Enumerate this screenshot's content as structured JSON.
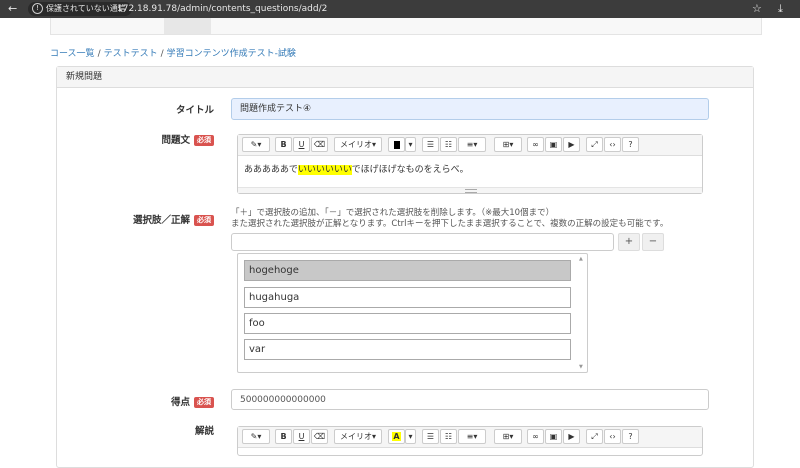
{
  "browser": {
    "security_label": "保護されていない通信",
    "url": "172.18.91.78/admin/contents_questions/add/2"
  },
  "breadcrumb": {
    "items": [
      "コース一覧",
      "テストテスト",
      "学習コンテンツ作成テスト-試験"
    ],
    "separator": "/"
  },
  "panel": {
    "heading": "新規問題"
  },
  "form": {
    "required_badge": "必須",
    "title_label": "タイトル",
    "title_value": "問題作成テスト④",
    "question_label": "問題文",
    "question_text_before": "あああああで",
    "question_text_highlight": "いいいいいい",
    "question_text_after": "でほげほげなものをえらべ。",
    "choices_label": "選択肢／正解",
    "choices_help_line1": "「＋」で選択肢の追加、「－」で選択された選択肢を削除します。（※最大10個まで）",
    "choices_help_line2": "また選択された選択肢が正解となります。Ctrlキーを押下したまま選択することで、複数の正解の設定も可能です。",
    "add_button": "+",
    "remove_button": "−",
    "choices": [
      {
        "label": "hogehoge",
        "selected": true
      },
      {
        "label": "hugahuga",
        "selected": false
      },
      {
        "label": "foo",
        "selected": false
      },
      {
        "label": "var",
        "selected": false
      }
    ],
    "score_label": "得点",
    "score_value": "500000000000000",
    "explanation_label": "解説"
  },
  "toolbar": {
    "font_name": "メイリオ",
    "dropdown_caret": "▾",
    "bold": "B",
    "underline": "U",
    "help": "?",
    "highlight_letter": "A"
  },
  "colors": {
    "required_badge": "#d9534f",
    "link": "#337ab7",
    "highlight": "#ffff00",
    "focused_input_bg": "#e8f0fe"
  }
}
